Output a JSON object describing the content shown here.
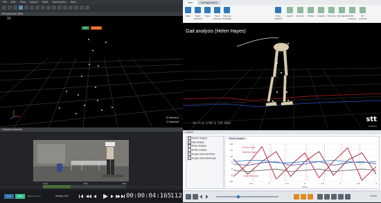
{
  "left_app": {
    "menu": [
      "File",
      "Edit",
      "View",
      "Layout",
      "Tools",
      "Community",
      "Help"
    ],
    "perspective_title": "Perspective View",
    "perspective_label": "3D",
    "btn_a": "SET",
    "btn_b": "Remote",
    "status_markers": "15 Markers",
    "status_selected": "0 Selected",
    "camera_title": "Camera Preview",
    "timeline_ticks": [
      "1000",
      "2000",
      "3000"
    ],
    "btn_live": "Live",
    "btn_edit": "Edit",
    "data_source_label": "Data Source",
    "take_name": "mkaba_019",
    "timecode": "00:00:04:165",
    "frame": "1125"
  },
  "right_app": {
    "tabs": [
      "Main",
      "Configuration"
    ],
    "ribbon_items": [
      "Open",
      "Open selected",
      "Save",
      "Save selected",
      "Save as template",
      "Close method",
      "Layout",
      "Camera",
      "Model",
      "Analysis",
      "Tracking",
      "Normalization",
      "3D Analysis",
      "3D Analysis"
    ],
    "overlay_title": "Gait analysis (Helen Hayes)",
    "overlay_status": "30.Clip 1/60 @ 240.00Hz",
    "logo_text": "stt",
    "logo_sub": "systems",
    "charts_title": "Charts",
    "tree": [
      "Pelvis Angles",
      "Hip Angles",
      "Knee Angles",
      "Ankle Angles",
      "Angle Velocity/Time",
      "Angle Velocity/Angle"
    ],
    "plot_tab": "Pelvis Angles",
    "zoom": "100%"
  },
  "chart_data": {
    "type": "line",
    "title": "",
    "xlabel": "Time",
    "ylabel": "",
    "xlim": [
      0,
      4
    ],
    "ylim": [
      -10,
      20
    ],
    "x_ticks": [
      "0.5",
      "1",
      "1.5",
      "2",
      "2.5",
      "3",
      "3.5",
      "4"
    ],
    "y_ticks": [
      "-10",
      "-5",
      "0",
      "5",
      "10",
      "15",
      "20"
    ],
    "annotations": [
      "Left Hip Angle",
      "Right Hip Angle",
      "Right foot strike"
    ],
    "series": [
      {
        "name": "",
        "color": "#c0182a",
        "x": [
          0,
          0.4,
          0.8,
          1.2,
          1.6,
          2.0,
          2.4,
          2.8,
          3.2,
          3.6,
          4.0
        ],
        "y": [
          -6,
          4,
          18,
          -8,
          3,
          13,
          -7,
          6,
          17,
          -9,
          2
        ]
      },
      {
        "name": "",
        "color": "#8b1a2c",
        "x": [
          0,
          0.4,
          0.8,
          1.2,
          1.6,
          2.0,
          2.4,
          2.8,
          3.2,
          3.6,
          4.0
        ],
        "y": [
          8,
          -4,
          6,
          14,
          -6,
          6,
          14,
          -5,
          7,
          13,
          -4
        ]
      },
      {
        "name": "",
        "color": "#5a5aa8",
        "x": [
          0,
          0.4,
          0.8,
          1.2,
          1.6,
          2.0,
          2.4,
          2.8,
          3.2,
          3.6,
          4.0
        ],
        "y": [
          4,
          3,
          5,
          6,
          3,
          4,
          6,
          3,
          5,
          6,
          4
        ]
      },
      {
        "name": "",
        "color": "#3c86c9",
        "x": [
          0,
          0.4,
          0.8,
          1.2,
          1.6,
          2.0,
          2.4,
          2.8,
          3.2,
          3.6,
          4.0
        ],
        "y": [
          6,
          7,
          7,
          5,
          5,
          6,
          6,
          7,
          6,
          5,
          6
        ]
      },
      {
        "name": "",
        "color": "#6e6e6e",
        "x": [
          0,
          0.4,
          0.8,
          1.2,
          1.6,
          2.0,
          2.4,
          2.8,
          3.2,
          3.6,
          4.0
        ],
        "y": [
          -1,
          -2,
          -1,
          0,
          -2,
          -1,
          0,
          -2,
          -1,
          0,
          -1
        ]
      }
    ]
  }
}
